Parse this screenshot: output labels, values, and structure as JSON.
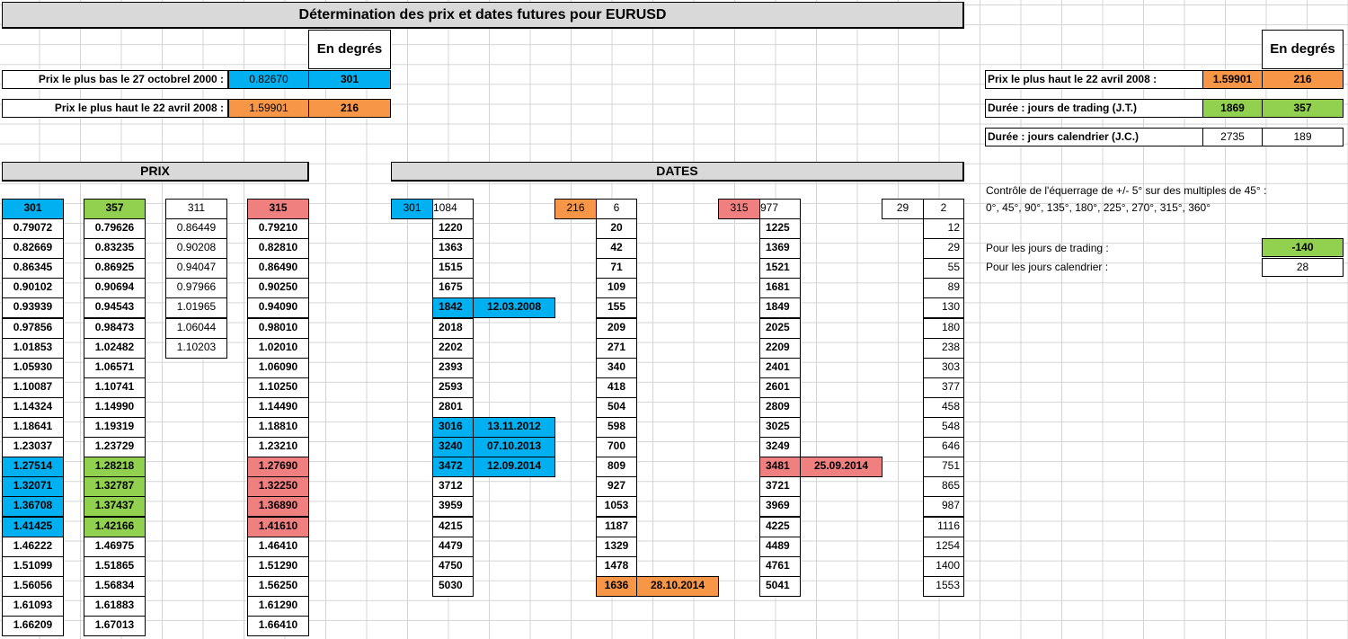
{
  "title": "Détermination des prix et dates futures pour EURUSD",
  "left_info": {
    "degrees_header": "En degrés",
    "low_label": "Prix le plus bas le 27 octobrel 2000 :",
    "low_price": "0.82670",
    "low_deg": "301",
    "high_label": "Prix le plus haut le 22 avril 2008 :",
    "high_price": "1.59901",
    "high_deg": "216"
  },
  "right_info": {
    "degrees_header": "En degrés",
    "high_label": "Prix le plus haut le 22 avril 2008 :",
    "high_price": "1.59901",
    "high_deg": "216",
    "trading_label": "Durée : jours de trading  (J.T.)",
    "trading_days": "1869",
    "trading_deg": "357",
    "calendar_label": "Durée : jours calendrier  (J.C.)",
    "calendar_days": "2735",
    "calendar_deg": "189"
  },
  "control": {
    "line1": "Contrôle de l'équerrage de +/- 5° sur des multiples de 45° :",
    "line2": "0°, 45°, 90°, 135°, 180°, 225°, 270°, 315°, 360°",
    "trading_label": "Pour les jours de trading :",
    "trading_value": "-140",
    "calendar_label": "Pour les jours calendrier :",
    "calendar_value": "28"
  },
  "prix": {
    "header": "PRIX",
    "col301": {
      "head": "301",
      "values": [
        "0.79072",
        "0.82669",
        "0.86345",
        "0.90102",
        "0.93939",
        "0.97856",
        "1.01853",
        "1.05930",
        "1.10087",
        "1.14324",
        "1.18641",
        "1.23037",
        "1.27514",
        "1.32071",
        "1.36708",
        "1.41425",
        "1.46222",
        "1.51099",
        "1.56056",
        "1.61093",
        "1.66209"
      ]
    },
    "col357": {
      "head": "357",
      "values": [
        "0.79626",
        "0.83235",
        "0.86925",
        "0.90694",
        "0.94543",
        "0.98473",
        "1.02482",
        "1.06571",
        "1.10741",
        "1.14990",
        "1.19319",
        "1.23729",
        "1.28218",
        "1.32787",
        "1.37437",
        "1.42166",
        "1.46975",
        "1.51865",
        "1.56834",
        "1.61883",
        "1.67013"
      ]
    },
    "col311": {
      "head": "311",
      "values": [
        "0.86449",
        "0.90208",
        "0.94047",
        "0.97966",
        "1.01965",
        "1.06044",
        "1.10203"
      ]
    },
    "col315": {
      "head": "315",
      "values": [
        "0.79210",
        "0.82810",
        "0.86490",
        "0.90250",
        "0.94090",
        "0.98010",
        "1.02010",
        "1.06090",
        "1.10250",
        "1.14490",
        "1.18810",
        "1.23210",
        "1.27690",
        "1.32250",
        "1.36890",
        "1.41610",
        "1.46410",
        "1.51290",
        "1.56250",
        "1.61290",
        "1.66410"
      ]
    }
  },
  "dates": {
    "header": "DATES",
    "g301": {
      "head": "301",
      "first": "1084",
      "values": [
        "1220",
        "1363",
        "1515",
        "1675",
        "1842",
        "2018",
        "2202",
        "2393",
        "2593",
        "2801",
        "3016",
        "3240",
        "3472",
        "3712",
        "3959",
        "4215",
        "4479",
        "4750",
        "5030"
      ],
      "date_labels": [
        "12.03.2008",
        "13.11.2012",
        "07.10.2013",
        "12.09.2014"
      ]
    },
    "g216": {
      "head": "216",
      "first": "6",
      "values": [
        "20",
        "42",
        "71",
        "109",
        "155",
        "209",
        "271",
        "340",
        "418",
        "504",
        "598",
        "700",
        "809",
        "927",
        "1053",
        "1187",
        "1329",
        "1478",
        "1636"
      ],
      "date_label": "28.10.2014"
    },
    "g315": {
      "head": "315",
      "first": "977",
      "values": [
        "1225",
        "1369",
        "1521",
        "1681",
        "1849",
        "2025",
        "2209",
        "2401",
        "2601",
        "2809",
        "3025",
        "3249",
        "3481",
        "3721",
        "3969",
        "4225",
        "4489",
        "4761",
        "5041"
      ],
      "date_label": "25.09.2014"
    },
    "g29": {
      "head": "29",
      "first": "2",
      "values": [
        "12",
        "29",
        "55",
        "89",
        "130",
        "180",
        "238",
        "303",
        "377",
        "458",
        "548",
        "646",
        "751",
        "865",
        "987",
        "1116",
        "1254",
        "1400",
        "1553"
      ]
    }
  }
}
